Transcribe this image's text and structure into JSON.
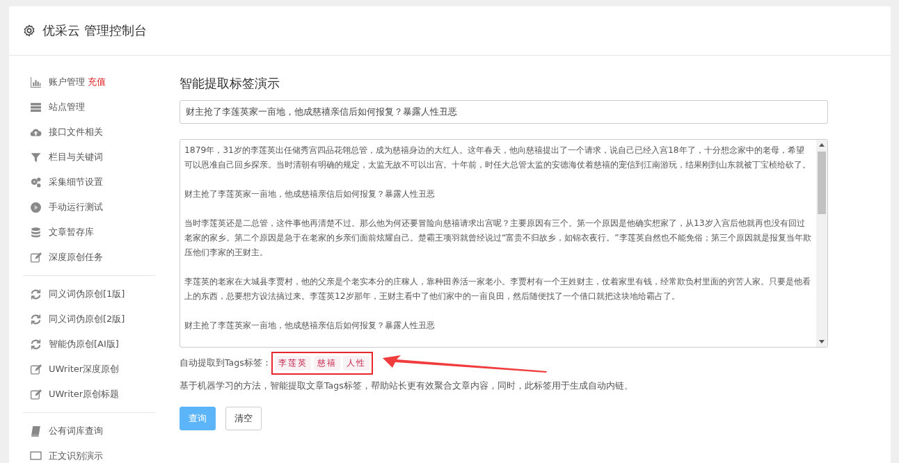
{
  "header": {
    "title": "优采云 管理控制台"
  },
  "sidebar": {
    "groups": [
      {
        "items": [
          {
            "label": "账户管理",
            "badge": "充值",
            "kind": "chart"
          },
          {
            "label": "站点管理",
            "kind": "server"
          },
          {
            "label": "接口文件相关",
            "kind": "cloud"
          },
          {
            "label": "栏目与关键词",
            "kind": "filter"
          },
          {
            "label": "采集细节设置",
            "kind": "gears"
          },
          {
            "label": "手动运行测试",
            "kind": "play"
          },
          {
            "label": "文章暂存库",
            "kind": "database"
          },
          {
            "label": "深度原创任务",
            "kind": "edit"
          }
        ]
      },
      {
        "items": [
          {
            "label": "同义词伪原创[1版]",
            "kind": "refresh"
          },
          {
            "label": "同义词伪原创[2版]",
            "kind": "refresh"
          },
          {
            "label": "智能伪原创[AI版]",
            "kind": "refresh"
          },
          {
            "label": "UWriter深度原创",
            "kind": "edit"
          },
          {
            "label": "UWriter原创标题",
            "kind": "edit"
          }
        ]
      },
      {
        "items": [
          {
            "label": "公有词库查询",
            "kind": "book"
          },
          {
            "label": "正文识别演示",
            "kind": "monitor"
          }
        ]
      }
    ]
  },
  "main": {
    "heading": "智能提取标签演示",
    "title_field": {
      "value": "财主抢了李莲英家一亩地，他成慈禧亲信后如何报复？暴露人性丑恶"
    },
    "content_field": {
      "paragraphs": [
        "1879年，31岁的李莲英出任储秀宫四品花翎总管，成为慈禧身边的大红人。这年春天，他向慈禧提出了一个请求，说自己已经入宫18年了，十分想念家中的老母，希望可以恩准自己回乡探亲。当时清朝有明确的规定，太监无故不可以出宫。十年前，时任大总管太监的安德海仗着慈禧的宠信到江南游玩，结果刚到山东就被丁宝桢给砍了。",
        "财主抢了李莲英家一亩地，他成慈禧亲信后如何报复？暴露人性丑恶",
        "当时李莲英还是二总管，这件事他再清楚不过。那么他为何还要冒险向慈禧请求出宫呢？主要原因有三个。第一个原因是他确实想家了，从13岁入宫后他就再也没有回过老家的家乡。第二个原因是急于在老家的乡亲们面前炫耀自己。楚霸王项羽就曾经说过“富贵不归故乡，如锦衣夜行。”李莲英自然也不能免俗；第三个原因就是报复当年欺压他们李家的王财主。",
        "李莲英的老家在大城县李贾村，他的父亲是个老实本分的庄稼人，靠种田养活一家老小。李贾村有一个王姓财主，仗着家里有钱，经常欺负村里面的穷苦人家。只要是他看上的东西，总要想方设法搞过来。李莲英12岁那年，王财主看中了他们家中的一亩良田，然后随便找了一个借口就把这块地给霸占了。",
        "财主抢了李莲英家一亩地，他成慈禧亲信后如何报复？暴露人性丑恶"
      ]
    },
    "tags_label": "自动提取到Tags标签：",
    "tags": [
      "李莲英",
      "慈禧",
      "人性"
    ],
    "tags_highlighted": true,
    "arrow_annotation": true,
    "description": "基于机器学习的方法，智能提取文章Tags标签，帮助站长更有效聚合文章内容，同时，此标签用于生成自动内链。",
    "buttons": [
      {
        "label": "查询",
        "kind": "primary"
      },
      {
        "label": "清空",
        "kind": "default"
      }
    ]
  }
}
